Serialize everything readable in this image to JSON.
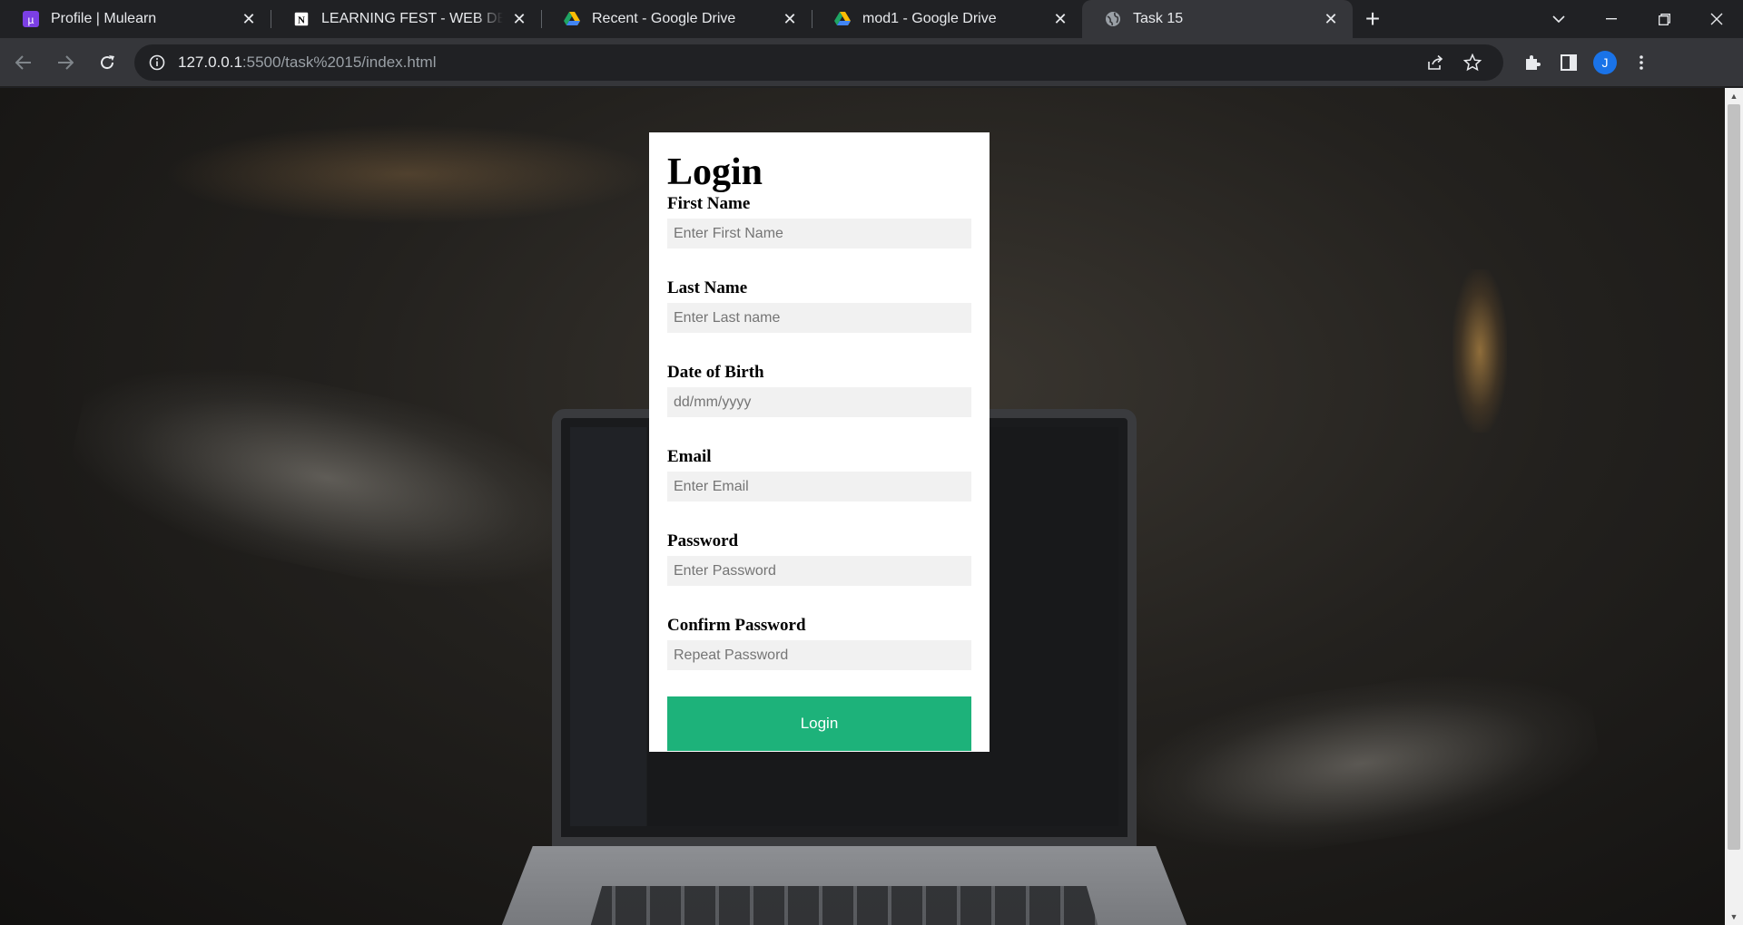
{
  "browser": {
    "tabs": [
      {
        "title": "Profile | Mulearn",
        "icon": "mulearn-logo-icon",
        "active": false
      },
      {
        "title": "LEARNING FEST - WEB DEVELOPMENT",
        "icon": "notion-logo-icon",
        "active": false
      },
      {
        "title": "Recent - Google Drive",
        "icon": "google-drive-icon",
        "active": false
      },
      {
        "title": "mod1 - Google Drive",
        "icon": "google-drive-icon",
        "active": false
      },
      {
        "title": "Task 15",
        "icon": "globe-icon",
        "active": true
      }
    ],
    "address": {
      "host": "127.0.0.1",
      "rest": ":5500/task%2015/index.html"
    },
    "profile_initial": "J",
    "accent_color": "#1a73e8"
  },
  "form": {
    "title": "Login",
    "fields": [
      {
        "label": "First Name",
        "placeholder": "Enter First Name",
        "type": "text"
      },
      {
        "label": "Last Name",
        "placeholder": "Enter Last name",
        "type": "text"
      },
      {
        "label": "Date of Birth",
        "placeholder": "dd/mm/yyyy",
        "type": "text"
      },
      {
        "label": "Email",
        "placeholder": "Enter Email",
        "type": "email"
      },
      {
        "label": "Password",
        "placeholder": "Enter Password",
        "type": "password"
      },
      {
        "label": "Confirm Password",
        "placeholder": "Repeat Password",
        "type": "password"
      }
    ],
    "submit_label": "Login",
    "button_color": "#1db27a"
  }
}
